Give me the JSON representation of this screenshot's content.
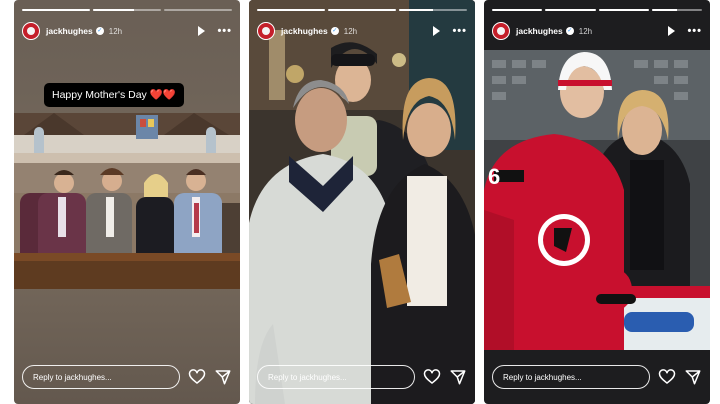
{
  "stories": [
    {
      "username": "jackhughes",
      "time": "12h",
      "reply_placeholder": "Reply to jackhughes...",
      "caption": {
        "text": "Happy Mother's Day",
        "emoji": "❤️❤️"
      },
      "progress": [
        1,
        0.6,
        0
      ]
    },
    {
      "username": "jackhughes",
      "time": "12h",
      "reply_placeholder": "Reply to jackhughes...",
      "progress": [
        1,
        1,
        0.5
      ]
    },
    {
      "username": "jackhughes",
      "time": "12h",
      "reply_placeholder": "Reply to jackhughes...",
      "jersey_number": "6",
      "progress": [
        1,
        1,
        1,
        0.5
      ]
    }
  ],
  "icons": [
    "play-icon",
    "more-options-icon",
    "heart-icon",
    "send-icon",
    "verified-badge-icon"
  ],
  "colors": {
    "devils_red": "#c8102e",
    "heart_red": "#e0102a",
    "story_bg": "#6a5f55"
  }
}
